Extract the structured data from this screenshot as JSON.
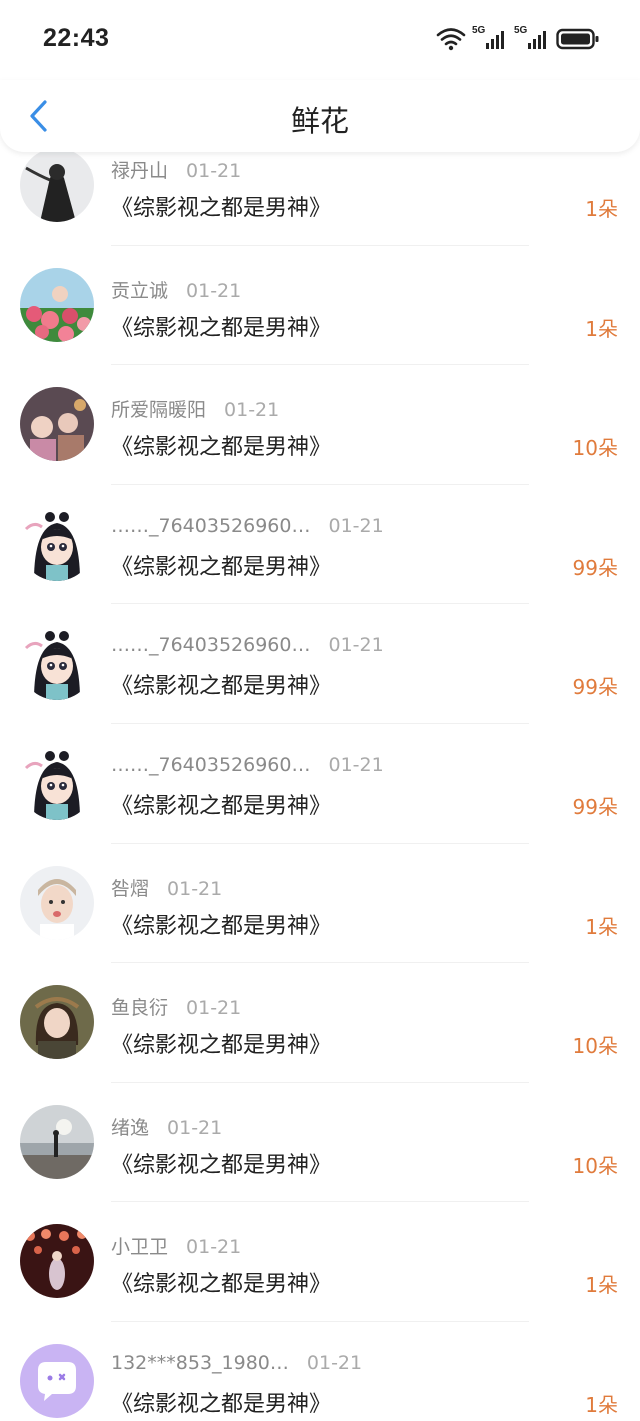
{
  "status_bar": {
    "time": "22:43",
    "net1": "5G",
    "net2": "5G"
  },
  "nav": {
    "title": "鲜花"
  },
  "colors": {
    "accent": "#3a8ee6",
    "count": "#e07b3c"
  },
  "rows": [
    {
      "name": "禄丹山",
      "date": "01-21",
      "book": "《综影视之都是男神》",
      "count": "1朵",
      "avatar": "dark-figure"
    },
    {
      "name": "贡立诚",
      "date": "01-21",
      "book": "《综影视之都是男神》",
      "count": "1朵",
      "avatar": "flowers"
    },
    {
      "name": "所爱隔暖阳",
      "date": "01-21",
      "book": "《综影视之都是男神》",
      "count": "10朵",
      "avatar": "group-photo"
    },
    {
      "name": "……_76403526960…",
      "date": "01-21",
      "book": "《综影视之都是男神》",
      "count": "99朵",
      "avatar": "cartoon-girl"
    },
    {
      "name": "……_76403526960…",
      "date": "01-21",
      "book": "《综影视之都是男神》",
      "count": "99朵",
      "avatar": "cartoon-girl"
    },
    {
      "name": "……_76403526960…",
      "date": "01-21",
      "book": "《综影视之都是男神》",
      "count": "99朵",
      "avatar": "cartoon-girl"
    },
    {
      "name": "咎熠",
      "date": "01-21",
      "book": "《综影视之都是男神》",
      "count": "1朵",
      "avatar": "boy-portrait"
    },
    {
      "name": "鱼良衍",
      "date": "01-21",
      "book": "《综影视之都是男神》",
      "count": "10朵",
      "avatar": "girl-portrait"
    },
    {
      "name": "绪逸",
      "date": "01-21",
      "book": "《综影视之都是男神》",
      "count": "10朵",
      "avatar": "beach"
    },
    {
      "name": "小卫卫",
      "date": "01-21",
      "book": "《综影视之都是男神》",
      "count": "1朵",
      "avatar": "lanterns"
    },
    {
      "name": "132***853_1980…",
      "date": "01-21",
      "book": "《综影视之都是男神》",
      "count": "1朵",
      "avatar": "chat-bubble"
    }
  ]
}
